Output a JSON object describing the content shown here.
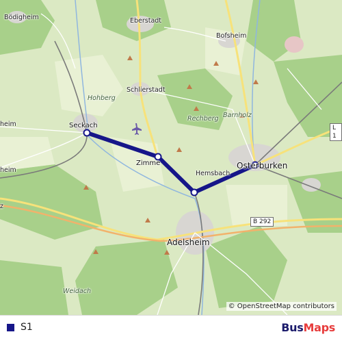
{
  "map": {
    "places": {
      "boedigheim": "Bödigheim",
      "eberstadt": "Eberstadt",
      "bofsheim": "Bofsheim",
      "schlierstadt": "Schlierstadt",
      "hohberg": "Hohberg",
      "barnholz": "Barnholz",
      "rechberg": "Rechberg",
      "heim_upper": "heim",
      "heim_lower": "heim",
      "z": "z",
      "adelsheim": "Adelsheim",
      "weidach": "Weidach",
      "hemsbach": "Hemsbach"
    },
    "roads": {
      "b292": "B 292",
      "l1": "L 1"
    },
    "attribution": "© OpenStreetMap contributors"
  },
  "route": {
    "color": "#161689",
    "stops": [
      "Seckach",
      "Zimmern",
      "Adelsheim",
      "Osterburken"
    ],
    "stop_labels": {
      "seckach": "Seckach",
      "zimmern": "Zimme",
      "osterburken": "Osterburken"
    }
  },
  "legend": {
    "line_label": "S1",
    "line_color": "#161689"
  },
  "brand": {
    "part1": "Bus",
    "part2": "Maps"
  }
}
